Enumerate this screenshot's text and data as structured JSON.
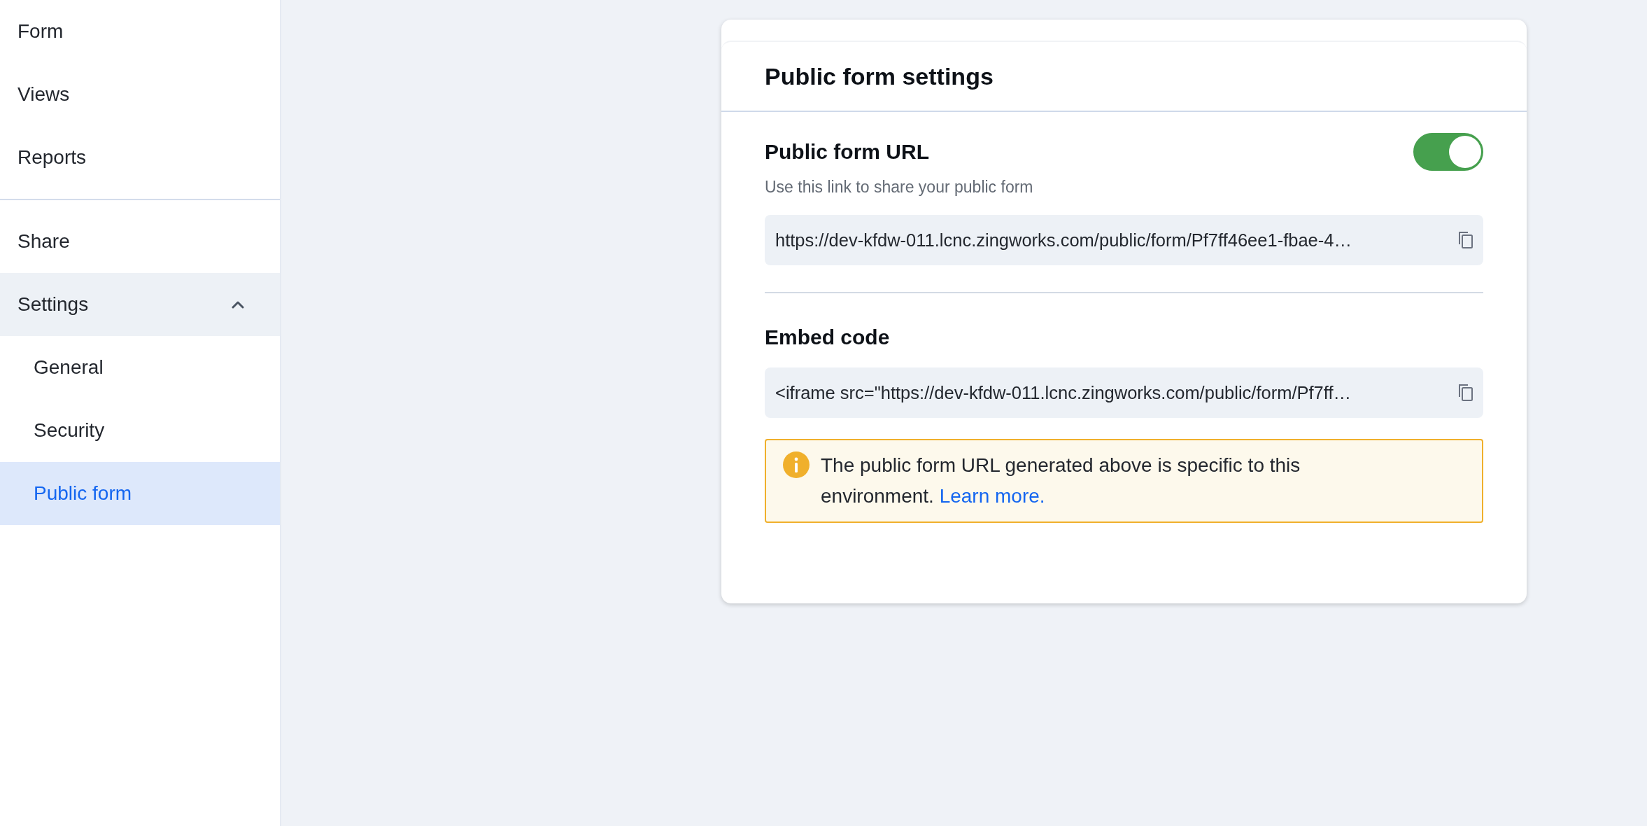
{
  "sidebar": {
    "sections": [
      {
        "items": [
          {
            "label": "Form",
            "selected": false
          },
          {
            "label": "Views",
            "selected": false
          },
          {
            "label": "Reports",
            "selected": false
          }
        ]
      },
      {
        "items": [
          {
            "label": "Share",
            "selected": false
          },
          {
            "label": "Settings",
            "selected": false,
            "expanded": true,
            "children": [
              {
                "label": "General",
                "selected": false
              },
              {
                "label": "Security",
                "selected": false
              },
              {
                "label": "Public form",
                "selected": true
              }
            ]
          }
        ]
      }
    ]
  },
  "card": {
    "title": "Public form settings",
    "public_url": {
      "heading": "Public form URL",
      "on": true,
      "description": "Use this link to share your public form",
      "value": "https://dev-kfdw-011.lcnc.zingworks.com/public/form/Pf7ff46ee1-fbae-4…"
    },
    "embed": {
      "heading": "Embed code",
      "value": "<iframe src=\"https://dev-kfdw-011.lcnc.zingworks.com/public/form/Pf7ff…"
    },
    "notice": {
      "text": "The public form URL generated above is specific to this environment.",
      "link": "Learn more."
    }
  }
}
